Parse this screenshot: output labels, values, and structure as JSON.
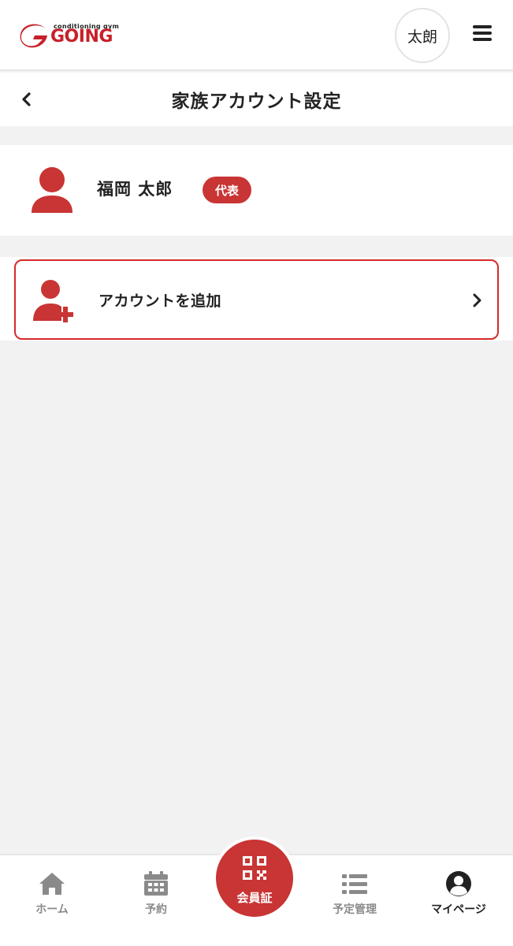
{
  "header": {
    "logo_small": "conditioning gym",
    "logo_big": "GOING",
    "avatar_label": "太朗"
  },
  "title_bar": {
    "title": "家族アカウント設定"
  },
  "member": {
    "name": "福岡 太郎",
    "badge": "代表"
  },
  "add_account": {
    "label": "アカウントを追加"
  },
  "bottom_nav": {
    "home": "ホーム",
    "reserve": "予約",
    "card": "会員証",
    "schedule": "予定管理",
    "mypage": "マイページ"
  },
  "colors": {
    "brand_red": "#c93434",
    "nav_inactive": "#8a8a8a",
    "nav_active": "#222222"
  }
}
